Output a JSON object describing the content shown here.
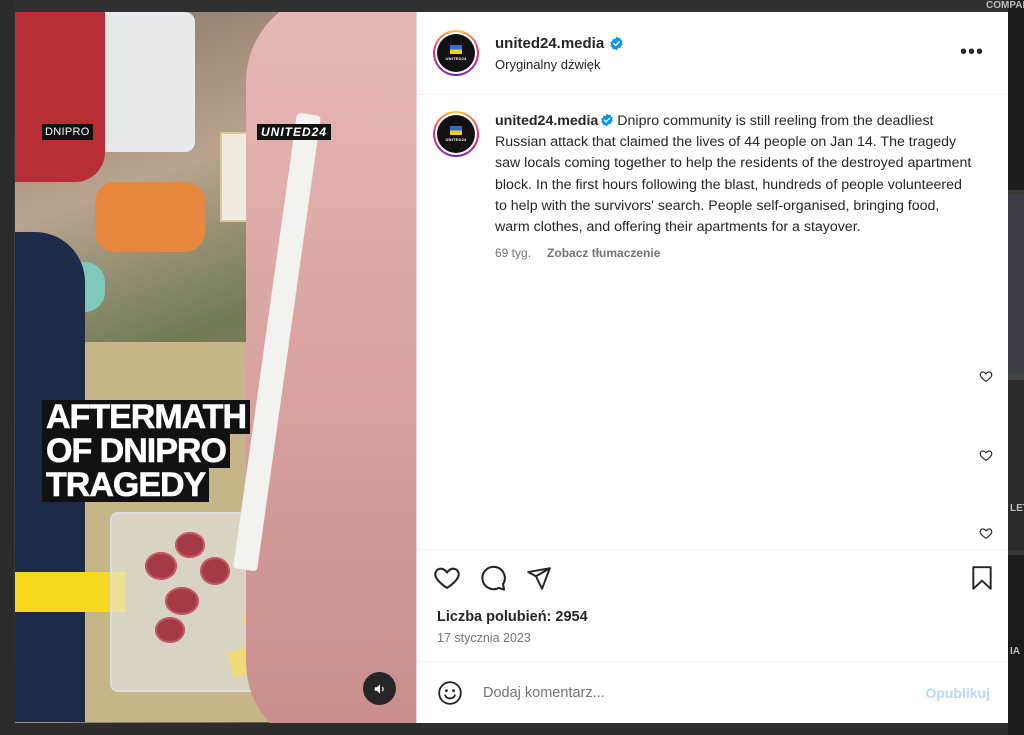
{
  "background": {
    "snippets": [
      "COMPARED",
      "LET",
      "IA"
    ]
  },
  "media": {
    "tag_location": "DNIPRO",
    "tag_brand": "UNITED24",
    "headline_lines": [
      "AFTERMATH",
      "OF DNIPRO",
      "TRAGEDY"
    ],
    "sound_icon": "speaker-icon"
  },
  "post": {
    "username": "united24.media",
    "audio_label": "Oryginalny dźwięk",
    "more_icon": "more-options-icon",
    "more_label": "•••",
    "avatar_word": "UNITED24"
  },
  "caption": {
    "username": "united24.media",
    "text": "Dnipro community is still reeling from the deadliest Russian attack that claimed the lives of 44 people on Jan 14. The tragedy saw locals coming together to help the residents of the destroyed apartment block. In the first hours following the blast, hundreds of people volunteered to help with the survivors' search. People self-organised, bringing food, warm clothes, and offering their apartments for a stayover.",
    "age": "69 tyg.",
    "translate_label": "Zobacz tłumaczenie"
  },
  "actions": {
    "like_icon": "heart-icon",
    "comment_icon": "comment-icon",
    "share_icon": "share-icon",
    "save_icon": "bookmark-icon"
  },
  "stats": {
    "likes_text": "Liczba polubień: 2954",
    "date_text": "17 stycznia 2023"
  },
  "comment_box": {
    "placeholder": "Dodaj komentarz...",
    "publish_label": "Opublikuj"
  },
  "colors": {
    "verified": "#0095f6",
    "publish_disabled": "#b7d7fb",
    "text_primary": "#262626",
    "text_secondary": "#737373"
  }
}
